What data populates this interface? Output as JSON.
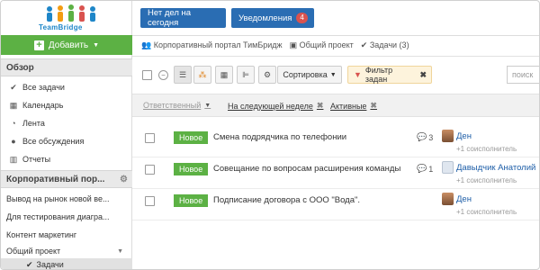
{
  "app": {
    "brand": "TeamBridge"
  },
  "sidebar": {
    "add_label": "Добавить",
    "overview_heading": "Обзор",
    "nav_items": [
      {
        "label": "Все задачи",
        "icon": "check-icon"
      },
      {
        "label": "Календарь",
        "icon": "calendar-icon"
      },
      {
        "label": "Лента",
        "icon": "rss-icon"
      },
      {
        "label": "Все обсуждения",
        "icon": "comments-icon"
      },
      {
        "label": "Отчеты",
        "icon": "chart-icon"
      }
    ],
    "portal_heading": "Корпоративный пор...",
    "projects": [
      {
        "label": "Вывод на рынок новой ве..."
      },
      {
        "label": "Для тестирования диагра..."
      },
      {
        "label": "Контент маркетинг"
      },
      {
        "label": "Общий проект"
      }
    ],
    "active_sub_item": "Задачи"
  },
  "topbar": {
    "no_tasks_label": "Нет дел на сегодня",
    "notifications_label": "Уведомления",
    "notifications_count": "4"
  },
  "breadcrumb": {
    "portal": "Корпоративный портал ТимБридж",
    "project": "Общий проект",
    "tasks": "Задачи (3)"
  },
  "toolbar": {
    "sort_label": "Сортировка",
    "filter_label": "Фильтр задан",
    "search_placeholder": "поиск"
  },
  "filters": {
    "responsible": "Ответственный",
    "next_week": "На следующей неделе",
    "active": "Активные"
  },
  "tasks": [
    {
      "status": "Новое",
      "title": "Смена подрядчика по телефонии",
      "comments": "3",
      "assignee": "Ден",
      "coexec": "+1 соисполнитель",
      "avatar": "photo"
    },
    {
      "status": "Новое",
      "title": "Совещание по вопросам расширения команды",
      "comments": "1",
      "assignee": "Давыдчик Анатолий",
      "coexec": "+1 соисполнитель",
      "avatar": "placeholder"
    },
    {
      "status": "Новое",
      "title": "Подписание договора с ООО \"Вода\".",
      "comments": "",
      "assignee": "Ден",
      "coexec": "+1 соисполнитель",
      "avatar": "photo"
    }
  ],
  "colors": {
    "green": "#5cb144",
    "blue": "#2a6db3",
    "badge": "#d9534f"
  }
}
